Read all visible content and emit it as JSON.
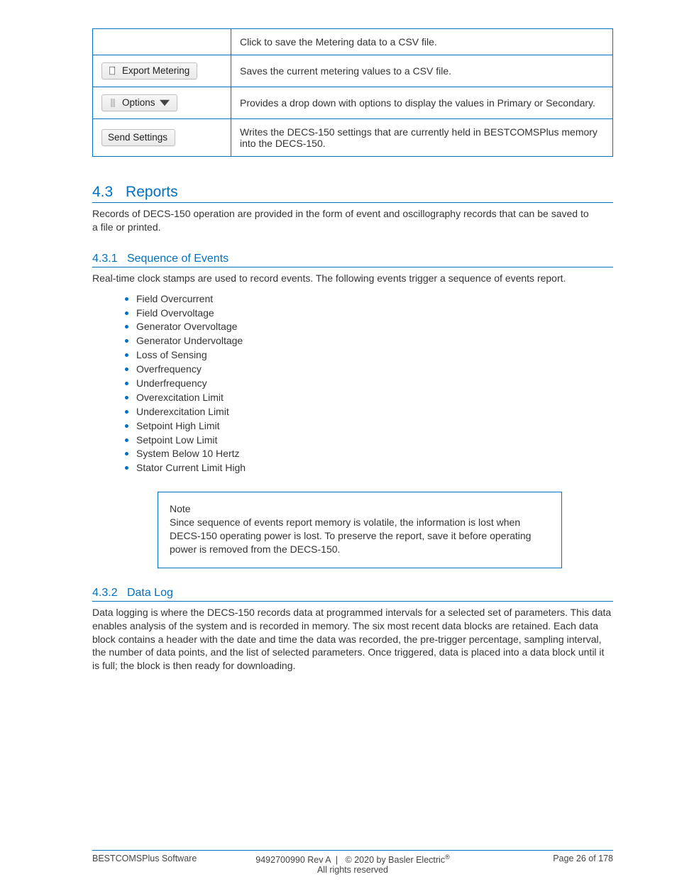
{
  "buttons_table": {
    "rows": [
      {
        "btn_label": "",
        "desc": "Click to save the Metering data to a CSV file."
      },
      {
        "btn_label": "Export Metering",
        "desc": "Saves the current metering values to a CSV file."
      },
      {
        "btn_label": "Options",
        "desc": "Provides a drop down with options to display the values in Primary or Secondary."
      },
      {
        "btn_label": "Send Settings",
        "desc": "Writes the DECS-150 settings that are currently held in BESTCOMSPlus memory into the DECS-150."
      }
    ]
  },
  "section1": {
    "heading_num": "4.3",
    "heading_text": "Reports",
    "intro": "Records of DECS-150 operation are provided in the form of event and oscillography records that can be saved to a file or printed."
  },
  "subsection1": {
    "heading_num": "4.3.1",
    "heading_text": "Sequence of Events",
    "intro": "Real-time clock stamps are used to record events. The following events trigger a sequence of events report.",
    "bullets": [
      "Field Overcurrent",
      "Field Overvoltage",
      "Generator Overvoltage",
      "Generator Undervoltage",
      "Loss of Sensing",
      "Overfrequency",
      "Underfrequency",
      "Overexcitation Limit",
      "Underexcitation Limit",
      "Setpoint High Limit",
      "Setpoint Low Limit",
      "System Below 10 Hertz",
      "Stator Current Limit High"
    ],
    "note": {
      "label": "Note",
      "body": "Since sequence of events report memory is volatile, the information is lost when DECS-150 operating power is lost. To preserve the report, save it before operating power is removed from the DECS-150."
    }
  },
  "subsection2": {
    "heading_num": "4.3.2",
    "heading_text": "Data Log",
    "intro": "Data logging is where the DECS-150 records data at programmed intervals for a selected set of parameters. This data enables analysis of the system and is recorded in memory. The six most recent data blocks are retained. Each data block contains a header with the date and time the data was recorded, the pre-trigger percentage, sampling interval, the number of data points, and the list of selected parameters. Once triggered, data is placed into a data block until it is full; the block is then ready for downloading."
  },
  "footer": {
    "left": "BESTCOMSPlus Software",
    "center1": "9492700990 Rev A |  © 2020 by Basler Electric",
    "center2": "All rights reserved",
    "right": "Page 26 of 178"
  }
}
